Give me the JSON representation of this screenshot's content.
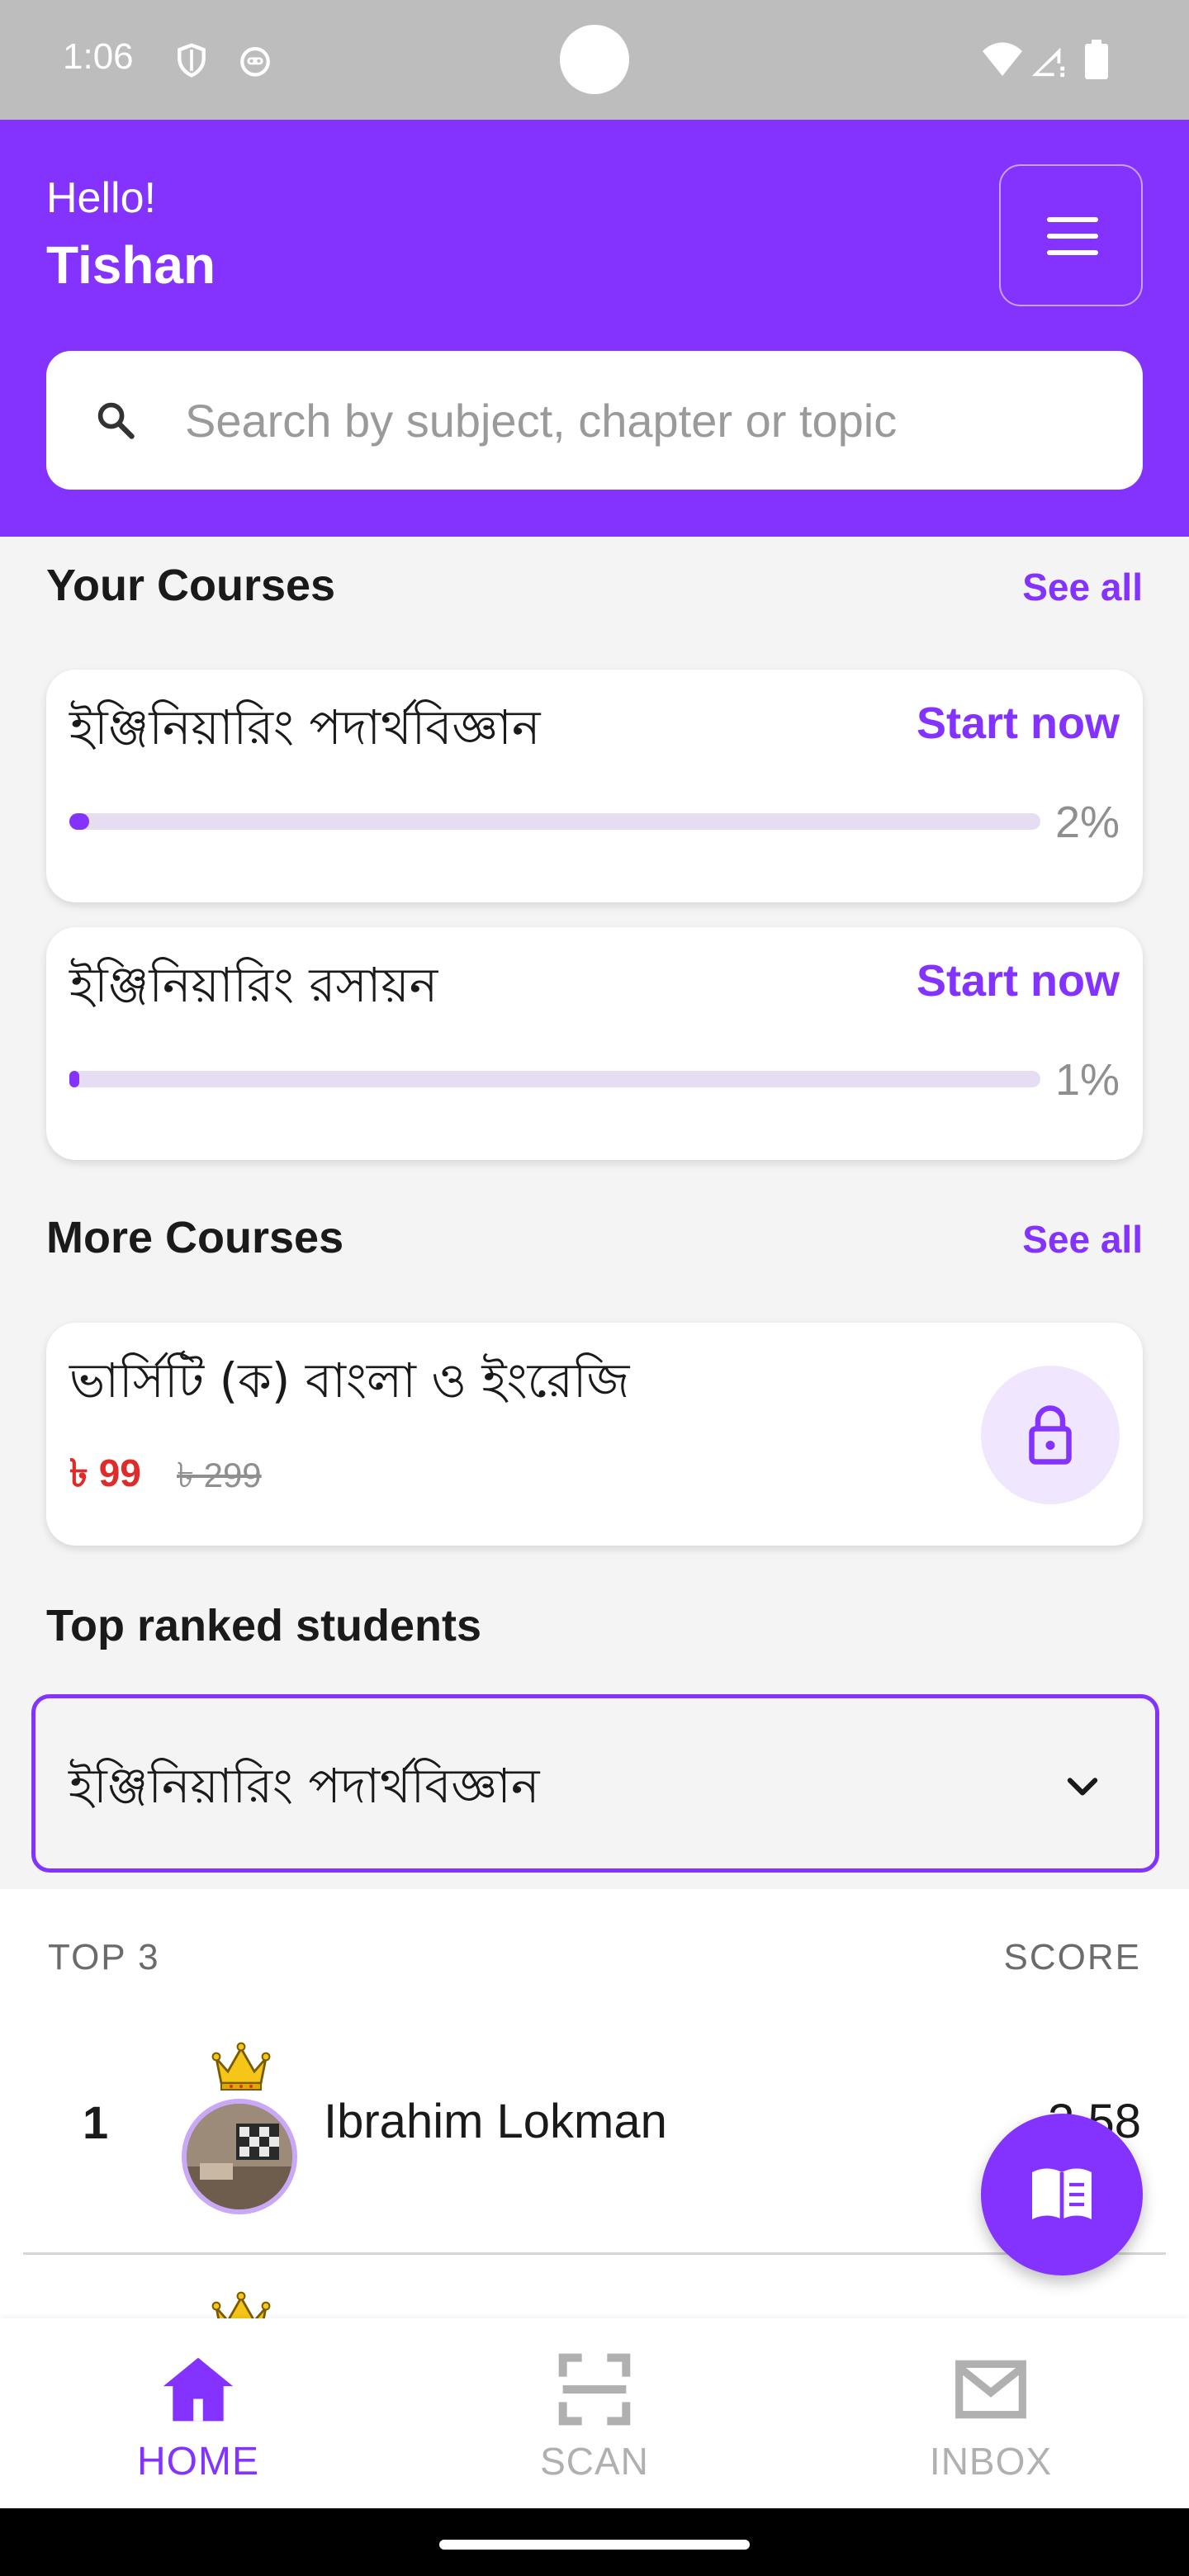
{
  "status_bar": {
    "time": "1:06",
    "icons": [
      "shield-icon",
      "robot-icon",
      "wifi-icon",
      "signal-icon",
      "battery-icon"
    ]
  },
  "header": {
    "greeting": "Hello!",
    "user_name": "Tishan",
    "menu_icon": "menu-icon",
    "background_color": "#8433ff"
  },
  "search": {
    "placeholder": "Search by subject, chapter or topic",
    "icon": "search-icon"
  },
  "your_courses": {
    "title": "Your Courses",
    "see_all": "See all",
    "items": [
      {
        "title": "ইঞ্জিনিয়ারিং পদার্থবিজ্ঞান",
        "action": "Start now",
        "progress_label": "2%",
        "progress": 0.02
      },
      {
        "title": "ইঞ্জিনিয়ারিং রসায়ন",
        "action": "Start now",
        "progress_label": "1%",
        "progress": 0.01
      }
    ]
  },
  "more_courses": {
    "title": "More Courses",
    "see_all": "See all",
    "items": [
      {
        "title": "ভার্সিটি (ক) বাংলা ও ইংরেজি",
        "price": "৳ 99",
        "original_price": "৳ 299",
        "icon": "lock-icon"
      }
    ]
  },
  "top_ranked": {
    "title": "Top ranked students",
    "selected_course": "ইঞ্জিনিয়ারিং পদার্থবিজ্ঞান",
    "col_left": "TOP 3",
    "col_right": "SCORE",
    "rows": [
      {
        "rank": "1",
        "name": "Ibrahim Lokman",
        "score": "3.58"
      }
    ]
  },
  "fab": {
    "icon": "book-icon"
  },
  "bottom_nav": {
    "items": [
      {
        "label": "HOME",
        "icon": "home-icon",
        "active": true
      },
      {
        "label": "SCAN",
        "icon": "scan-icon",
        "active": false
      },
      {
        "label": "INBOX",
        "icon": "mail-icon",
        "active": false
      }
    ]
  },
  "colors": {
    "accent": "#8433ff",
    "price": "#e02b2b",
    "progress_track": "#e6ddf2"
  }
}
